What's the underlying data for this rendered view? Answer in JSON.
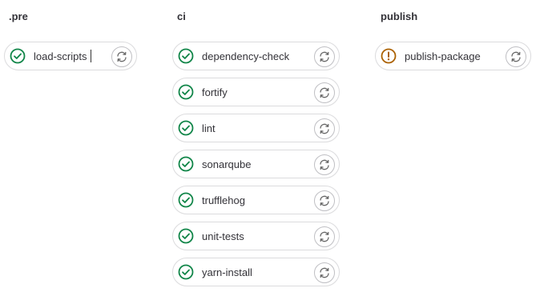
{
  "stages": [
    {
      "title": ".pre",
      "jobs": [
        {
          "name": "load-scripts",
          "status": "success"
        }
      ]
    },
    {
      "title": "ci",
      "jobs": [
        {
          "name": "dependency-check",
          "status": "success"
        },
        {
          "name": "fortify",
          "status": "success"
        },
        {
          "name": "lint",
          "status": "success"
        },
        {
          "name": "sonarqube",
          "status": "success"
        },
        {
          "name": "trufflehog",
          "status": "success"
        },
        {
          "name": "unit-tests",
          "status": "success"
        },
        {
          "name": "yarn-install",
          "status": "success"
        }
      ]
    },
    {
      "title": "publish",
      "jobs": [
        {
          "name": "publish-package",
          "status": "warning"
        }
      ]
    }
  ],
  "colors": {
    "success": "#108548",
    "warning": "#ab6100"
  },
  "icons": {
    "success": "check-circle-icon",
    "warning": "exclamation-circle-icon",
    "retry": "retry-icon"
  }
}
